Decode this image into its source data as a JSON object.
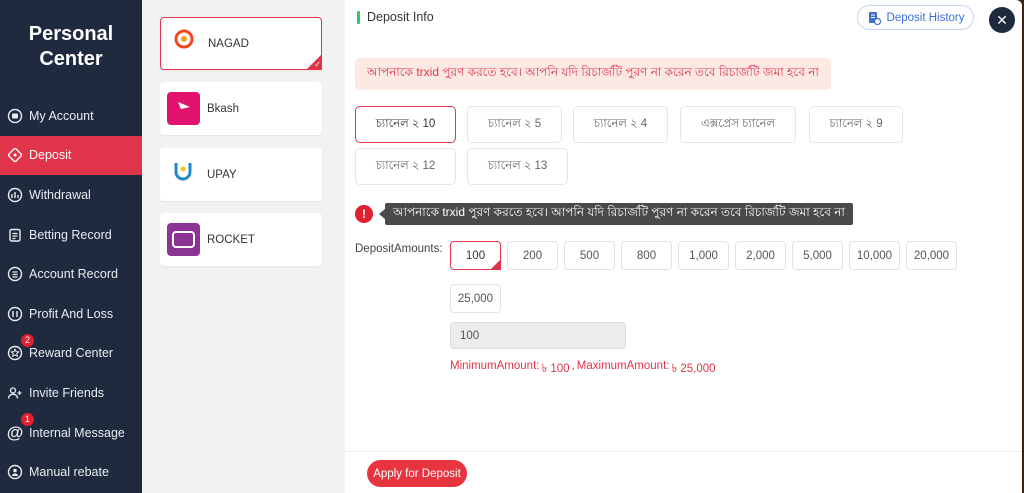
{
  "sidebar": {
    "title": "Personal\nCenter",
    "items": [
      {
        "label": "My Account",
        "icon": "account-icon",
        "badge": ""
      },
      {
        "label": "Deposit",
        "icon": "deposit-icon",
        "badge": ""
      },
      {
        "label": "Withdrawal",
        "icon": "withdrawal-icon",
        "badge": ""
      },
      {
        "label": "Betting Record",
        "icon": "betting-record-icon",
        "badge": ""
      },
      {
        "label": "Account Record",
        "icon": "account-record-icon",
        "badge": ""
      },
      {
        "label": "Profit And Loss",
        "icon": "profit-loss-icon",
        "badge": ""
      },
      {
        "label": "Reward Center",
        "icon": "reward-icon",
        "badge": "2"
      },
      {
        "label": "Invite Friends",
        "icon": "invite-icon",
        "badge": ""
      },
      {
        "label": "Internal Message",
        "icon": "at-icon",
        "badge": "1"
      },
      {
        "label": "Manual rebate",
        "icon": "rebate-icon",
        "badge": ""
      }
    ]
  },
  "payment_methods": [
    {
      "label": "NAGAD",
      "logo_text": "নগদ",
      "color": "#ffffff"
    },
    {
      "label": "Bkash",
      "logo_text": "",
      "color": "#e2136e"
    },
    {
      "label": "UPAY",
      "logo_text": "উপায়",
      "color": "#ffffff"
    },
    {
      "label": "ROCKET",
      "logo_text": "রকেট",
      "color": "#8c3494"
    }
  ],
  "deposit": {
    "heading": "Deposit Info",
    "history_label": "Deposit History",
    "notice": "আপনাকে trxid পুরণ করতে হবে। আপনি যদি রিচার্জটি পুরণ না করেন তবে রিচার্জটি জমা হবে না",
    "channels": [
      "চ্যানেল ২ 10",
      "চ্যানেল ২ 5",
      "চ্যানেল ২ 4",
      "এক্সপ্রেস চ্যানেল",
      "চ্যানেল ২ 9",
      "চ্যানেল ২ 12",
      "চ্যানেল ২ 13"
    ],
    "warning": "আপনাকে trxid পুরণ করতে হবে। আপনি যদি রিচার্জটি পুরণ না করেন তবে রিচার্জটি জমা হবে না",
    "amounts_label": "DepositAmounts:",
    "amounts": [
      "100",
      "200",
      "500",
      "800",
      "1,000",
      "2,000",
      "5,000",
      "10,000",
      "20,000",
      "25,000"
    ],
    "input_value": "100",
    "min_label": "MinimumAmount:",
    "min_value": "৳ 100",
    "separator": ",",
    "max_label": "MaximumAmount:",
    "max_value": "৳ 25,000",
    "apply_label": "Apply for Deposit"
  },
  "colors": {
    "accent": "#e0344a",
    "sidebar_bg": "#1f2a3e",
    "link_blue": "#3a6fd8"
  }
}
